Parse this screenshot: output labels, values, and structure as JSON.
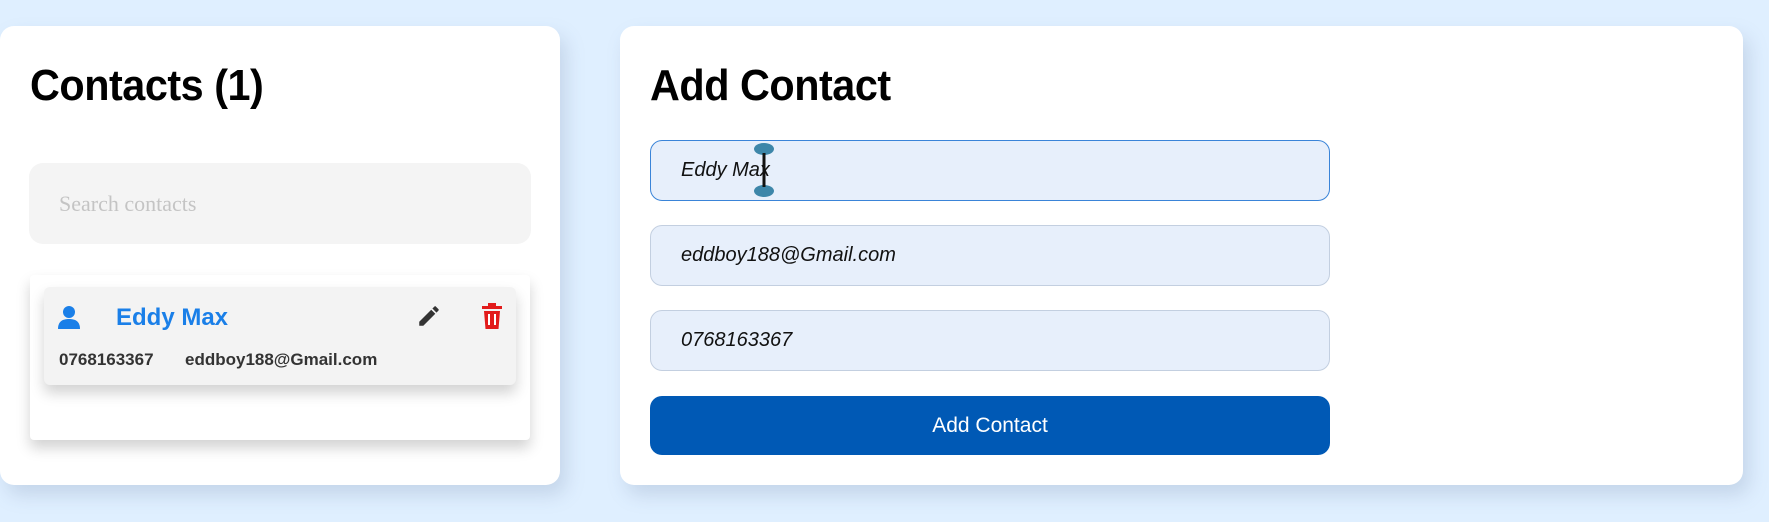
{
  "contacts_panel": {
    "title": "Contacts (1)",
    "search": {
      "placeholder": "Search contacts",
      "value": ""
    },
    "items": [
      {
        "name": "Eddy Max",
        "phone": "0768163367",
        "email": "eddboy188@Gmail.com",
        "icons": [
          "person-icon",
          "pencil-icon",
          "trash-icon"
        ]
      }
    ]
  },
  "add_panel": {
    "title": "Add Contact",
    "name_field": {
      "value": "Eddy Max"
    },
    "email_field": {
      "value": "eddboy188@Gmail.com"
    },
    "phone_field": {
      "value": "0768163367"
    },
    "submit_label": "Add Contact"
  },
  "colors": {
    "background": "#dfefff",
    "accent_blue": "#1a7fe8",
    "button_blue": "#0059b5",
    "delete_red": "#e21b1b",
    "field_bg": "#e7effb"
  }
}
